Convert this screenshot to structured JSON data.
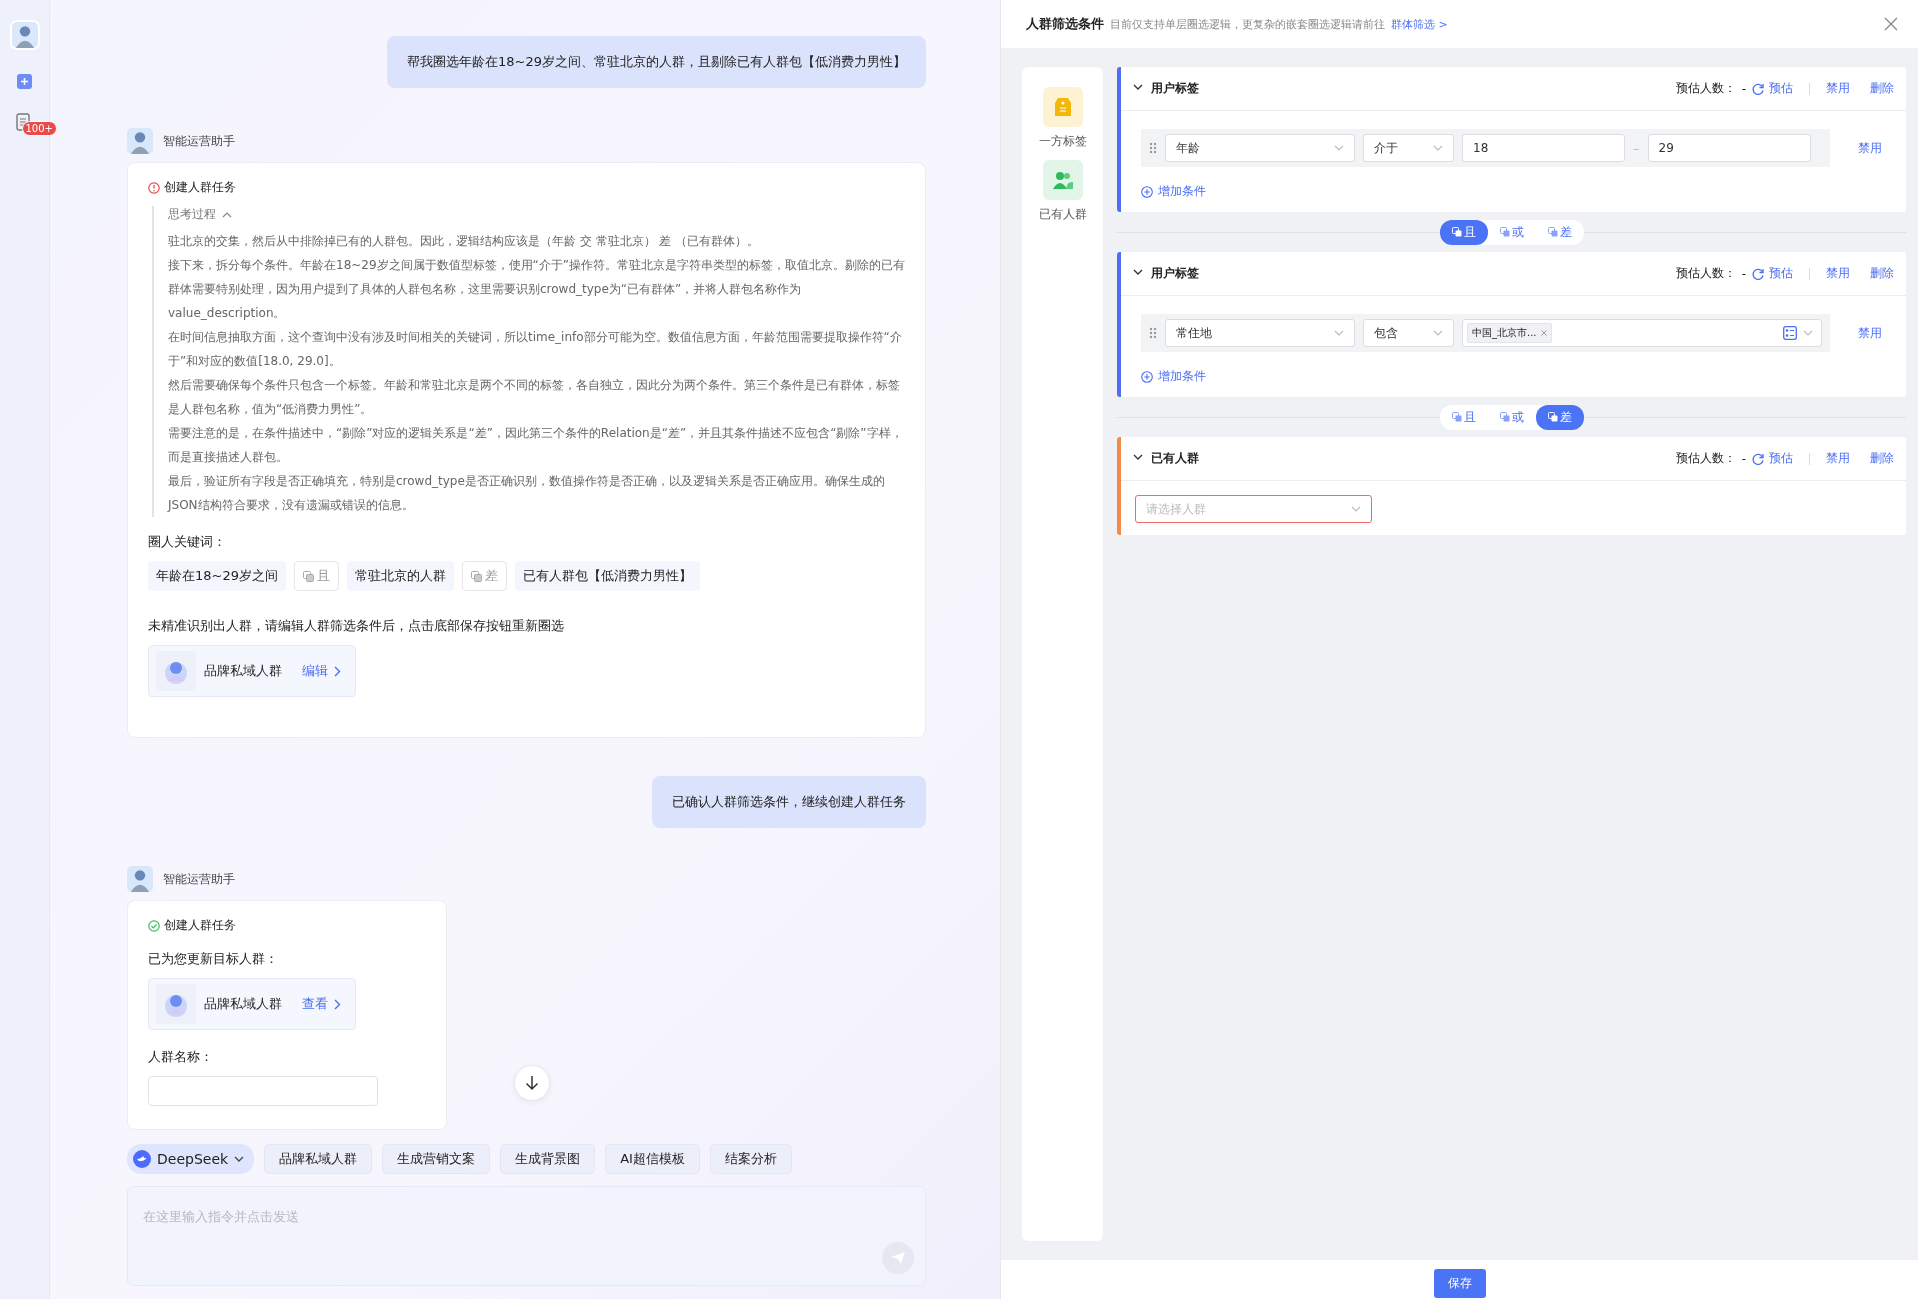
{
  "sidebar": {
    "badge": "100+"
  },
  "chat": {
    "messages": [
      {
        "kind": "user",
        "text": "帮我圈选年龄在18~29岁之间、常驻北京的人群，且剔除已有人群包【低消费力男性】"
      },
      {
        "kind": "assistant",
        "name": "智能运营助手",
        "failed": true,
        "task_title": "创建人群任务",
        "blocks": [
          {
            "kind": "thinking",
            "title": "思考过程",
            "expanded": true,
            "paragraphs": [
              "驻北京的交集，然后从中排除掉已有的人群包。因此，逻辑结构应该是（年龄 交 常驻北京） 差 （已有群体）。",
              "接下来，拆分每个条件。年龄在18~29岁之间属于数值型标签，使用“介于”操作符。常驻北京是字符串类型的标签，取值北京。剔除的已有群体需要特别处理，因为用户提到了具体的人群包名称，这里需要识别crowd_type为“已有群体”，并将人群包名称作为value_description。",
              "在时间信息抽取方面，这个查询中没有涉及时间相关的关键词，所以time_info部分可能为空。数值信息方面，年龄范围需要提取操作符“介于”和对应的数值[18.0, 29.0]。",
              "然后需要确保每个条件只包含一个标签。年龄和常驻北京是两个不同的标签，各自独立，因此分为两个条件。第三个条件是已有群体，标签是人群包名称，值为“低消费力男性”。",
              "需要注意的是，在条件描述中，“剔除”对应的逻辑关系是“差”，因此第三个条件的Relation是“差”，并且其条件描述不应包含“剔除”字样，而是直接描述人群包。",
              "最后，验证所有字段是否正确填充，特别是crowd_type是否正确识别，数值操作符是否正确，以及逻辑关系是否正确应用。确保生成的JSON结构符合要求，没有遗漏或错误的信息。"
            ]
          },
          {
            "kind": "label",
            "text": "圈人关键词："
          },
          {
            "kind": "keywords",
            "items": [
              {
                "kind": "keyword",
                "text": "年龄在18~29岁之间"
              },
              {
                "kind": "operator",
                "text": "且"
              },
              {
                "kind": "keyword",
                "text": "常驻北京的人群"
              },
              {
                "kind": "operator",
                "text": "差"
              },
              {
                "kind": "keyword",
                "text": "已有人群包【低消费力男性】"
              }
            ]
          },
          {
            "kind": "note",
            "text": "未精准识别出人群，请编辑人群筛选条件后，点击底部保存按钮重新圈选"
          },
          {
            "kind": "crowd_card",
            "name": "品牌私域人群",
            "action": "编辑"
          }
        ]
      },
      {
        "kind": "user",
        "text": "已确认人群筛选条件，继续创建人群任务"
      },
      {
        "kind": "assistant",
        "name": "智能运营助手",
        "failed": false,
        "task_title": "创建人群任务",
        "blocks": [
          {
            "kind": "label",
            "text": "已为您更新目标人群："
          },
          {
            "kind": "crowd_card",
            "name": "品牌私域人群",
            "action": "查看"
          },
          {
            "kind": "label",
            "text": "人群名称："
          },
          {
            "kind": "field"
          }
        ]
      }
    ]
  },
  "toolbar": {
    "model": "DeepSeek",
    "chips": [
      "品牌私域人群",
      "生成营销文案",
      "生成背景图",
      "AI超信模板",
      "结案分析"
    ]
  },
  "composer": {
    "placeholder": "在这里输入指令并点击发送"
  },
  "panel": {
    "title": "人群筛选条件",
    "subtitle": "目前仅支持单层圈选逻辑，更复杂的嵌套圈选逻辑请前往",
    "link": "群体筛选 >",
    "palette": [
      {
        "kind": "tag",
        "label": "一方标签"
      },
      {
        "kind": "crowd",
        "label": "已有人群"
      }
    ],
    "blocks": [
      {
        "kind": "tag_group",
        "title": "用户标签",
        "expanded": true,
        "estimate_label": "预估人数：",
        "estimate_value": "-",
        "estimate_action": "预估",
        "disable": "禁用",
        "delete": "删除",
        "add": "增加条件",
        "conditions": [
          {
            "kind": "range",
            "field": "年龄",
            "operator": "介于",
            "from": "18",
            "separator": "–",
            "to": "29",
            "action": "禁用"
          }
        ]
      },
      {
        "kind": "relation",
        "options": [
          {
            "label": "且",
            "selected": true
          },
          {
            "label": "或",
            "selected": false
          },
          {
            "label": "差",
            "selected": false
          }
        ]
      },
      {
        "kind": "tag_group",
        "title": "用户标签",
        "expanded": true,
        "estimate_label": "预估人数：",
        "estimate_value": "-",
        "estimate_action": "预估",
        "disable": "禁用",
        "delete": "删除",
        "add": "增加条件",
        "conditions": [
          {
            "kind": "tags",
            "field": "常住地",
            "operator": "包含",
            "tags": [
              "中国_北京市..."
            ],
            "action": "禁用"
          }
        ]
      },
      {
        "kind": "relation",
        "options": [
          {
            "label": "且",
            "selected": false
          },
          {
            "label": "或",
            "selected": false
          },
          {
            "label": "差",
            "selected": true
          }
        ]
      },
      {
        "kind": "crowd_group",
        "title": "已有人群",
        "expanded": true,
        "estimate_label": "预估人数：",
        "estimate_value": "-",
        "estimate_action": "预估",
        "disable": "禁用",
        "delete": "删除",
        "select": {
          "placeholder": "请选择人群",
          "invalid": true
        }
      }
    ],
    "save": "保存"
  }
}
